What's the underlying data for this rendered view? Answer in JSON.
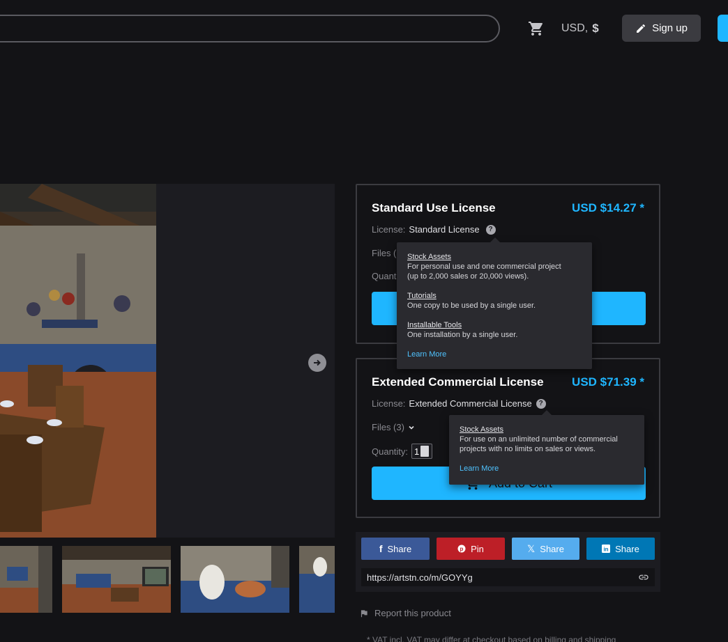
{
  "header": {
    "search_placeholder": "",
    "currency_label": "USD,",
    "currency_symbol": "$",
    "signup_label": "Sign up",
    "icons": [
      "cart-icon",
      "pencil-icon"
    ]
  },
  "licenses": [
    {
      "title": "Standard Use License",
      "price": "USD $14.27 *",
      "license_label": "License:",
      "license_value": "Standard License",
      "files_label": "Files (",
      "quantity_label": "Quant"
    },
    {
      "title": "Extended Commercial License",
      "price": "USD $71.39 *",
      "license_label": "License:",
      "license_value": "Extended Commercial License",
      "files_label": "Files (3)",
      "quantity_label": "Quantity:",
      "quantity_value": "1",
      "add_to_cart": "Add to Cart"
    }
  ],
  "tooltip_standard": {
    "sections": [
      {
        "heading": "Stock Assets",
        "lines": [
          "For personal use and one commercial project",
          "(up to 2,000 sales or 20,000 views)."
        ]
      },
      {
        "heading": "Tutorials",
        "lines": [
          "One copy to be used by a single user."
        ]
      },
      {
        "heading": "Installable Tools",
        "lines": [
          "One installation by a single user."
        ]
      }
    ],
    "learn_more": "Learn More"
  },
  "tooltip_extended": {
    "sections": [
      {
        "heading": "Stock Assets",
        "lines": [
          "For use on an unlimited number of commercial",
          "projects with no limits on sales or views."
        ]
      }
    ],
    "learn_more": "Learn More"
  },
  "share": {
    "facebook": "Share",
    "pinterest": "Pin",
    "x": "Share",
    "linkedin": "Share",
    "url": "https://artstn.co/m/GOYYg",
    "colors": {
      "facebook": "#3b5998",
      "pinterest": "#bd1f27",
      "x": "#55acee",
      "linkedin": "#0077b5"
    }
  },
  "report_label": "Report this product",
  "vat_note": "* VAT incl. VAT may differ at checkout based on billing and shipping"
}
